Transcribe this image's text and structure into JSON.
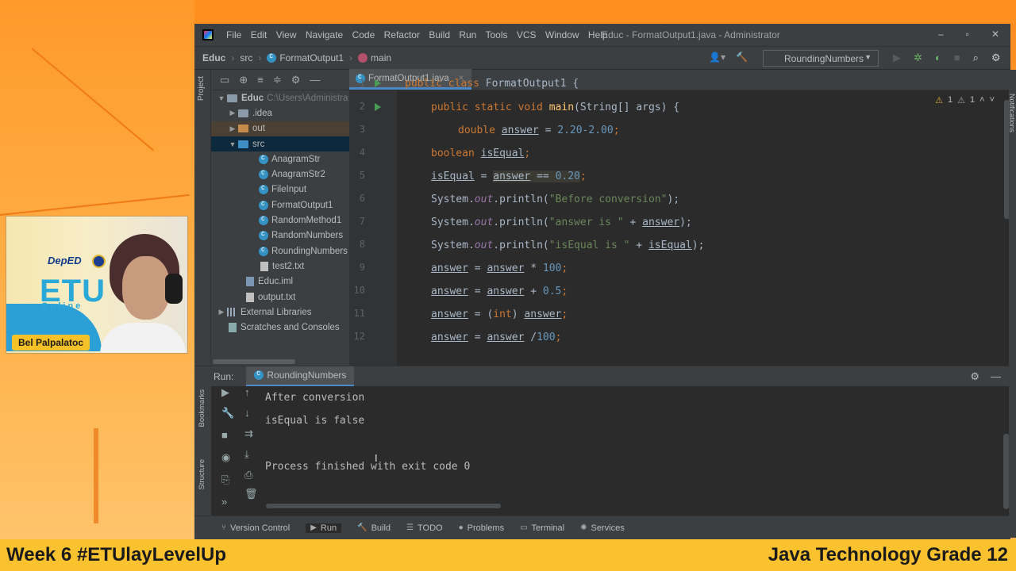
{
  "ide": {
    "menu": [
      "File",
      "Edit",
      "View",
      "Navigate",
      "Code",
      "Refactor",
      "Build",
      "Run",
      "Tools",
      "VCS",
      "Window",
      "Help"
    ],
    "window_title": "Educ - FormatOutput1.java - Administrator",
    "breadcrumb": {
      "project": "Educ",
      "folder": "src",
      "class": "FormatOutput1",
      "method": "main"
    },
    "run_config": "RoundingNumbers"
  },
  "project": {
    "label": "Project",
    "root": "Educ",
    "root_path": "C:\\Users\\Administra",
    "idea": ".idea",
    "out": "out",
    "src": "src",
    "files": [
      "AnagramStr",
      "AnagramStr2",
      "FileInput",
      "FormatOutput1",
      "RandomMethod1",
      "RandomNumbers",
      "RoundingNumbers"
    ],
    "txt": "test2.txt",
    "iml": "Educ.iml",
    "output": "output.txt",
    "ext_libs": "External Libraries",
    "scratches": "Scratches and Consoles"
  },
  "editor": {
    "tab": "FormatOutput1.java",
    "line_numbers": [
      "1",
      "2",
      "3",
      "4",
      "5",
      "6",
      "7",
      "8",
      "9",
      "10",
      "11",
      "12"
    ],
    "warnings": "1",
    "weak_warnings": "1"
  },
  "code": {
    "l1_kw": "public class",
    "l1_rest": " FormatOutput1 {",
    "l2_kw": "public static void",
    "l2_fn": "main",
    "l2_rest": "(String[] args) {",
    "l3_kw": "double",
    "l3_var": "answer",
    "l3_eq": " = ",
    "l3_num": "2.20-2.00",
    "l3_end": ";",
    "l4_kw": "boolean",
    "l4_var": "isEqual",
    "l4_end": ";",
    "l5_var": "isEqual",
    "l5_eq": " = ",
    "l5_hl_var": "answer",
    "l5_op": " == ",
    "l5_num": "0.20",
    "l5_end": ";",
    "sys": "System.",
    "out": "out",
    "println": ".println(",
    "l6_str": "\"Before conversion\"",
    "l6_end": ");",
    "l7_str": "\"answer is \"",
    "l7_plus": " + ",
    "l7_var": "answer",
    "l7_end": ");",
    "l8_str": "\"isEqual is \"",
    "l8_plus": " + ",
    "l8_var": "isEqual",
    "l8_end": ");",
    "l9_a": "answer",
    "l9_eq": " = ",
    "l9_b": "answer",
    "l9_op": " * ",
    "l9_num": "100",
    "l9_end": ";",
    "l10_a": "answer",
    "l10_eq": " = ",
    "l10_b": "answer",
    "l10_op": " + ",
    "l10_num": "0.5",
    "l10_end": ";",
    "l11_a": "answer",
    "l11_eq": " = (",
    "l11_kw": "int",
    "l11_cl": ") ",
    "l11_b": "answer",
    "l11_end": ";",
    "l12_a": "answer",
    "l12_eq": " = ",
    "l12_b": "answer",
    "l12_op": " /",
    "l12_num": "100",
    "l12_end": ";"
  },
  "run": {
    "label": "Run:",
    "tab": "RoundingNumbers",
    "output": [
      "After conversion",
      "isEqual is false",
      "",
      "Process finished with exit code 0"
    ]
  },
  "side_labels": {
    "bookmarks": "Bookmarks",
    "structure": "Structure",
    "notifications": "Notifications"
  },
  "status": [
    "Version Control",
    "Run",
    "Build",
    "TODO",
    "Problems",
    "Terminal",
    "Services"
  ],
  "webcam": {
    "name": "Bel Palpalatoc",
    "brand": "ETU",
    "deped": "DepED",
    "online": "Online"
  },
  "ticker": {
    "left": "Week 6 #ETUlayLevelUp",
    "right": "Java Technology Grade 12"
  }
}
